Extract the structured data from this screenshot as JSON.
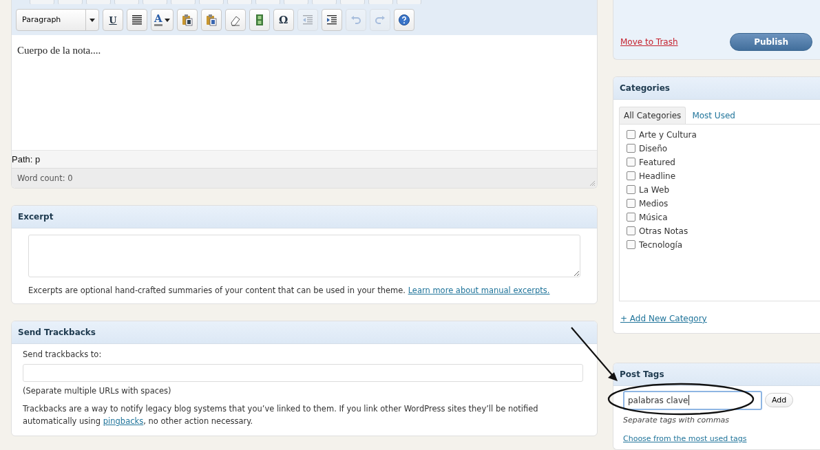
{
  "editor": {
    "toolbar": [
      {
        "kind": "select",
        "label": "Paragraph",
        "disabled": false
      },
      {
        "kind": "underline",
        "label": "U",
        "disabled": false
      },
      {
        "kind": "justify",
        "disabled": false
      },
      {
        "kind": "text-color",
        "label": "A",
        "disabled": false
      },
      {
        "kind": "paste-text",
        "disabled": false
      },
      {
        "kind": "paste-word",
        "disabled": false
      },
      {
        "kind": "eraser",
        "disabled": false
      },
      {
        "kind": "media",
        "disabled": false
      },
      {
        "kind": "char",
        "label": "Ω",
        "disabled": false
      },
      {
        "kind": "outdent",
        "disabled": true
      },
      {
        "kind": "indent",
        "disabled": false
      },
      {
        "kind": "undo",
        "disabled": true
      },
      {
        "kind": "redo",
        "disabled": true
      },
      {
        "kind": "help",
        "disabled": false
      }
    ],
    "body": "Cuerpo de la nota....",
    "path": "Path: p",
    "word_count": "Word count: 0"
  },
  "excerpt": {
    "title": "Excerpt",
    "note": "Excerpts are optional hand-crafted summaries of your content that can be used in your theme.",
    "link": "Learn more about manual excerpts."
  },
  "trackbacks": {
    "title": "Send Trackbacks",
    "label": "Send trackbacks to:",
    "hint": "(Separate multiple URLs with spaces)",
    "text_before": "Trackbacks are a way to notify legacy blog systems that you’ve linked to them. If you link other WordPress sites they’ll be notified automatically using",
    "link": "pingbacks",
    "text_after": ", no other action necessary."
  },
  "publish": {
    "trash": "Move to Trash",
    "button": "Publish"
  },
  "categories": {
    "title": "Categories",
    "tabs": [
      {
        "label": "All Categories",
        "selected": true
      },
      {
        "label": "Most Used",
        "selected": false
      }
    ],
    "items": [
      {
        "label": "Arte y Cultura",
        "checked": false
      },
      {
        "label": "Diseño",
        "checked": false
      },
      {
        "label": "Featured",
        "checked": false
      },
      {
        "label": "Headline",
        "checked": false
      },
      {
        "label": "La Web",
        "checked": false
      },
      {
        "label": "Medios",
        "checked": false
      },
      {
        "label": "Música",
        "checked": false
      },
      {
        "label": "Otras Notas",
        "checked": false
      },
      {
        "label": "Tecnología",
        "checked": false
      }
    ],
    "add_link": "+ Add New Category"
  },
  "tags": {
    "title": "Post Tags",
    "value": "palabras clave",
    "button": "Add",
    "hint": "Separate tags with commas",
    "link": "Choose from the most used tags"
  }
}
